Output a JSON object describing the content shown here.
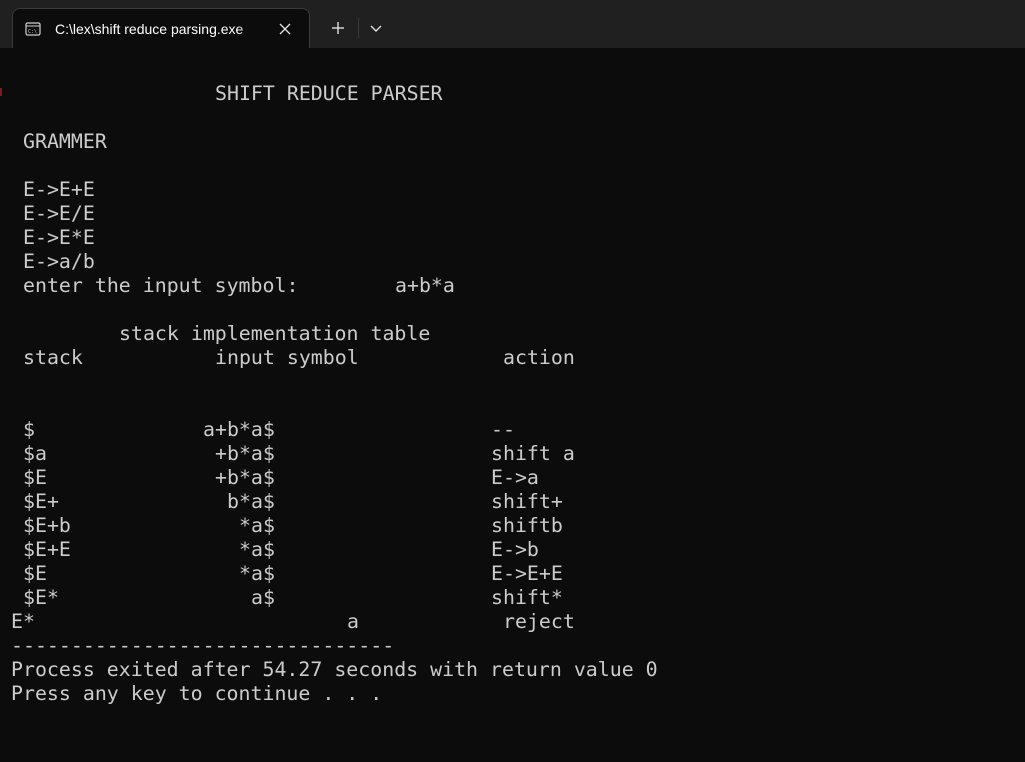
{
  "tab": {
    "title": "C:\\lex\\shift reduce parsing.exe",
    "icon": "terminal-icon"
  },
  "controls": {
    "close_icon": "close-icon",
    "new_tab_icon": "plus-icon",
    "dropdown_icon": "chevron-down-icon"
  },
  "terminal": {
    "heading": "SHIFT REDUCE PARSER",
    "grammar_label": "GRAMMER",
    "grammar_rules": [
      "E->E+E",
      "E->E/E",
      "E->E*E",
      "E->a/b"
    ],
    "input_prompt": "enter the input symbol:",
    "input_value": "a+b*a",
    "table_title": "stack implementation table",
    "columns": [
      "stack",
      "input symbol",
      "action"
    ],
    "rows": [
      {
        "stack": "$",
        "input": "a+b*a$",
        "action": "--"
      },
      {
        "stack": "$a",
        "input": "+b*a$",
        "action": "shift a"
      },
      {
        "stack": "$E",
        "input": "+b*a$",
        "action": "E->a"
      },
      {
        "stack": "$E+",
        "input": "b*a$",
        "action": "shift+"
      },
      {
        "stack": "$E+b",
        "input": "*a$",
        "action": "shiftb"
      },
      {
        "stack": "$E+E",
        "input": "*a$",
        "action": "E->b"
      },
      {
        "stack": "$E",
        "input": "*a$",
        "action": "E->E+E"
      },
      {
        "stack": "$E*",
        "input": "a$",
        "action": "shift*"
      }
    ],
    "final_row": {
      "stack": "E*",
      "input": "a",
      "action": "reject"
    },
    "separator": "--------------------------------",
    "exit_message": "Process exited after 54.27 seconds with return value 0",
    "continue_message": "Press any key to continue . . ."
  }
}
